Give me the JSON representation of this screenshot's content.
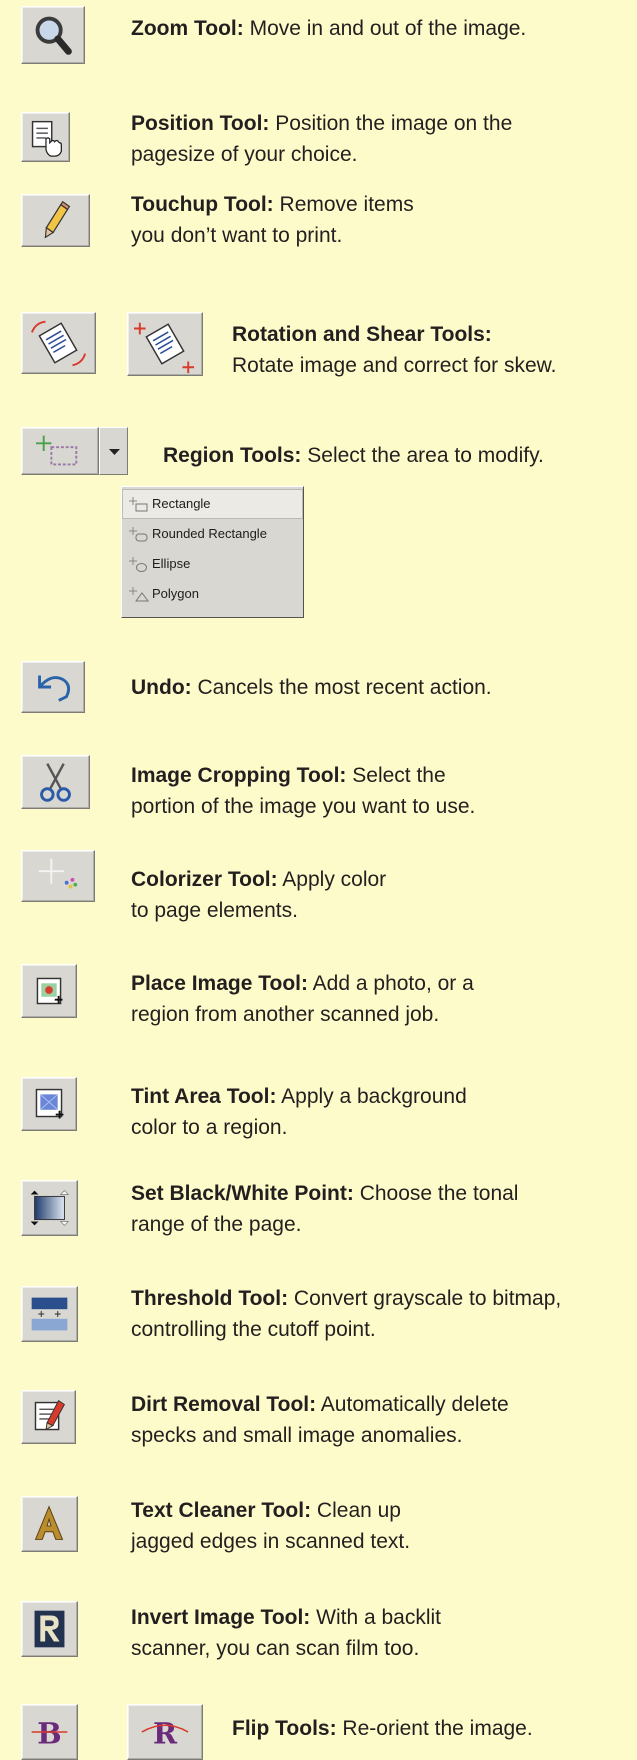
{
  "tools": {
    "zoom": {
      "name": "Zoom Tool:",
      "text": " Move in and out of the image."
    },
    "position": {
      "name": "Position Tool:",
      "text": " Position the image on the",
      "line2": "pagesize of your choice."
    },
    "touchup": {
      "name": "Touchup Tool:",
      "text": " Remove items",
      "line2": "you don’t want to print."
    },
    "rotation": {
      "name": "Rotation and Shear Tools:",
      "line2": "Rotate image and correct for skew."
    },
    "region": {
      "name": "Region Tools:",
      "text": " Select the area to modify."
    },
    "undo": {
      "name": "Undo:",
      "text": " Cancels the most recent action."
    },
    "crop": {
      "name": "Image Cropping Tool:",
      "text": " Select the",
      "line2": "portion of the image you want to use."
    },
    "colorizer": {
      "name": "Colorizer Tool:",
      "text": " Apply color",
      "line2": "to page elements."
    },
    "place": {
      "name": "Place Image Tool:",
      "text": "  Add a photo, or a",
      "line2": "region from another scanned job."
    },
    "tint": {
      "name": "Tint Area Tool:",
      "text": " Apply a background",
      "line2": "color to a region."
    },
    "blackwhite": {
      "name": "Set Black/White Point:",
      "text": " Choose the tonal",
      "line2": "range of the page."
    },
    "threshold": {
      "name": "Threshold Tool:",
      "text": "  Convert grayscale to bitmap,",
      "line2": "controlling the cutoff point."
    },
    "dirt": {
      "name": "Dirt Removal Tool:",
      "text": " Automatically delete",
      "line2": "specks and small image anomalies."
    },
    "textcleaner": {
      "name": "Text Cleaner Tool:",
      "text": " Clean up",
      "line2": "jagged edges in scanned text."
    },
    "invert": {
      "name": "Invert Image Tool:",
      "text": " With a backlit",
      "line2": "scanner, you can scan film too."
    },
    "flip": {
      "name": "Flip Tools:",
      "text": "  Re-orient the image."
    }
  },
  "region_menu": {
    "items": [
      "Rectangle",
      "Rounded Rectangle",
      "Ellipse",
      "Polygon"
    ],
    "selected": "Rectangle"
  },
  "colors": {
    "background": "#fdfbc9",
    "button_face": "#d8d7d2"
  }
}
